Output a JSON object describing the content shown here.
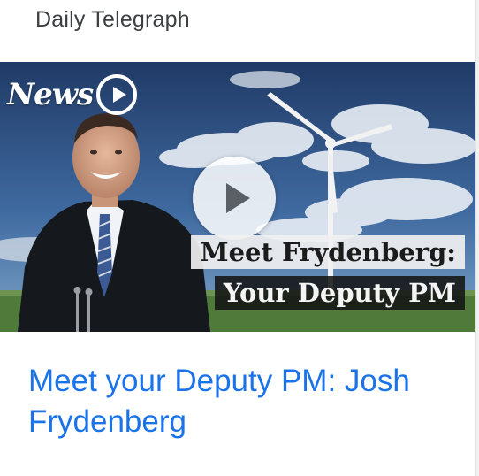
{
  "card": {
    "source": "Daily Telegraph",
    "thumbnail": {
      "brand": "News",
      "brand_icon": "play-circle-icon",
      "play_icon": "play-icon",
      "caption_line1": "Meet Frydenberg:",
      "caption_line2": "Your Deputy PM"
    },
    "headline": "Meet your Deputy PM: Josh Frydenberg"
  },
  "colors": {
    "headline": "#1a73e8",
    "source": "#3c4043"
  }
}
